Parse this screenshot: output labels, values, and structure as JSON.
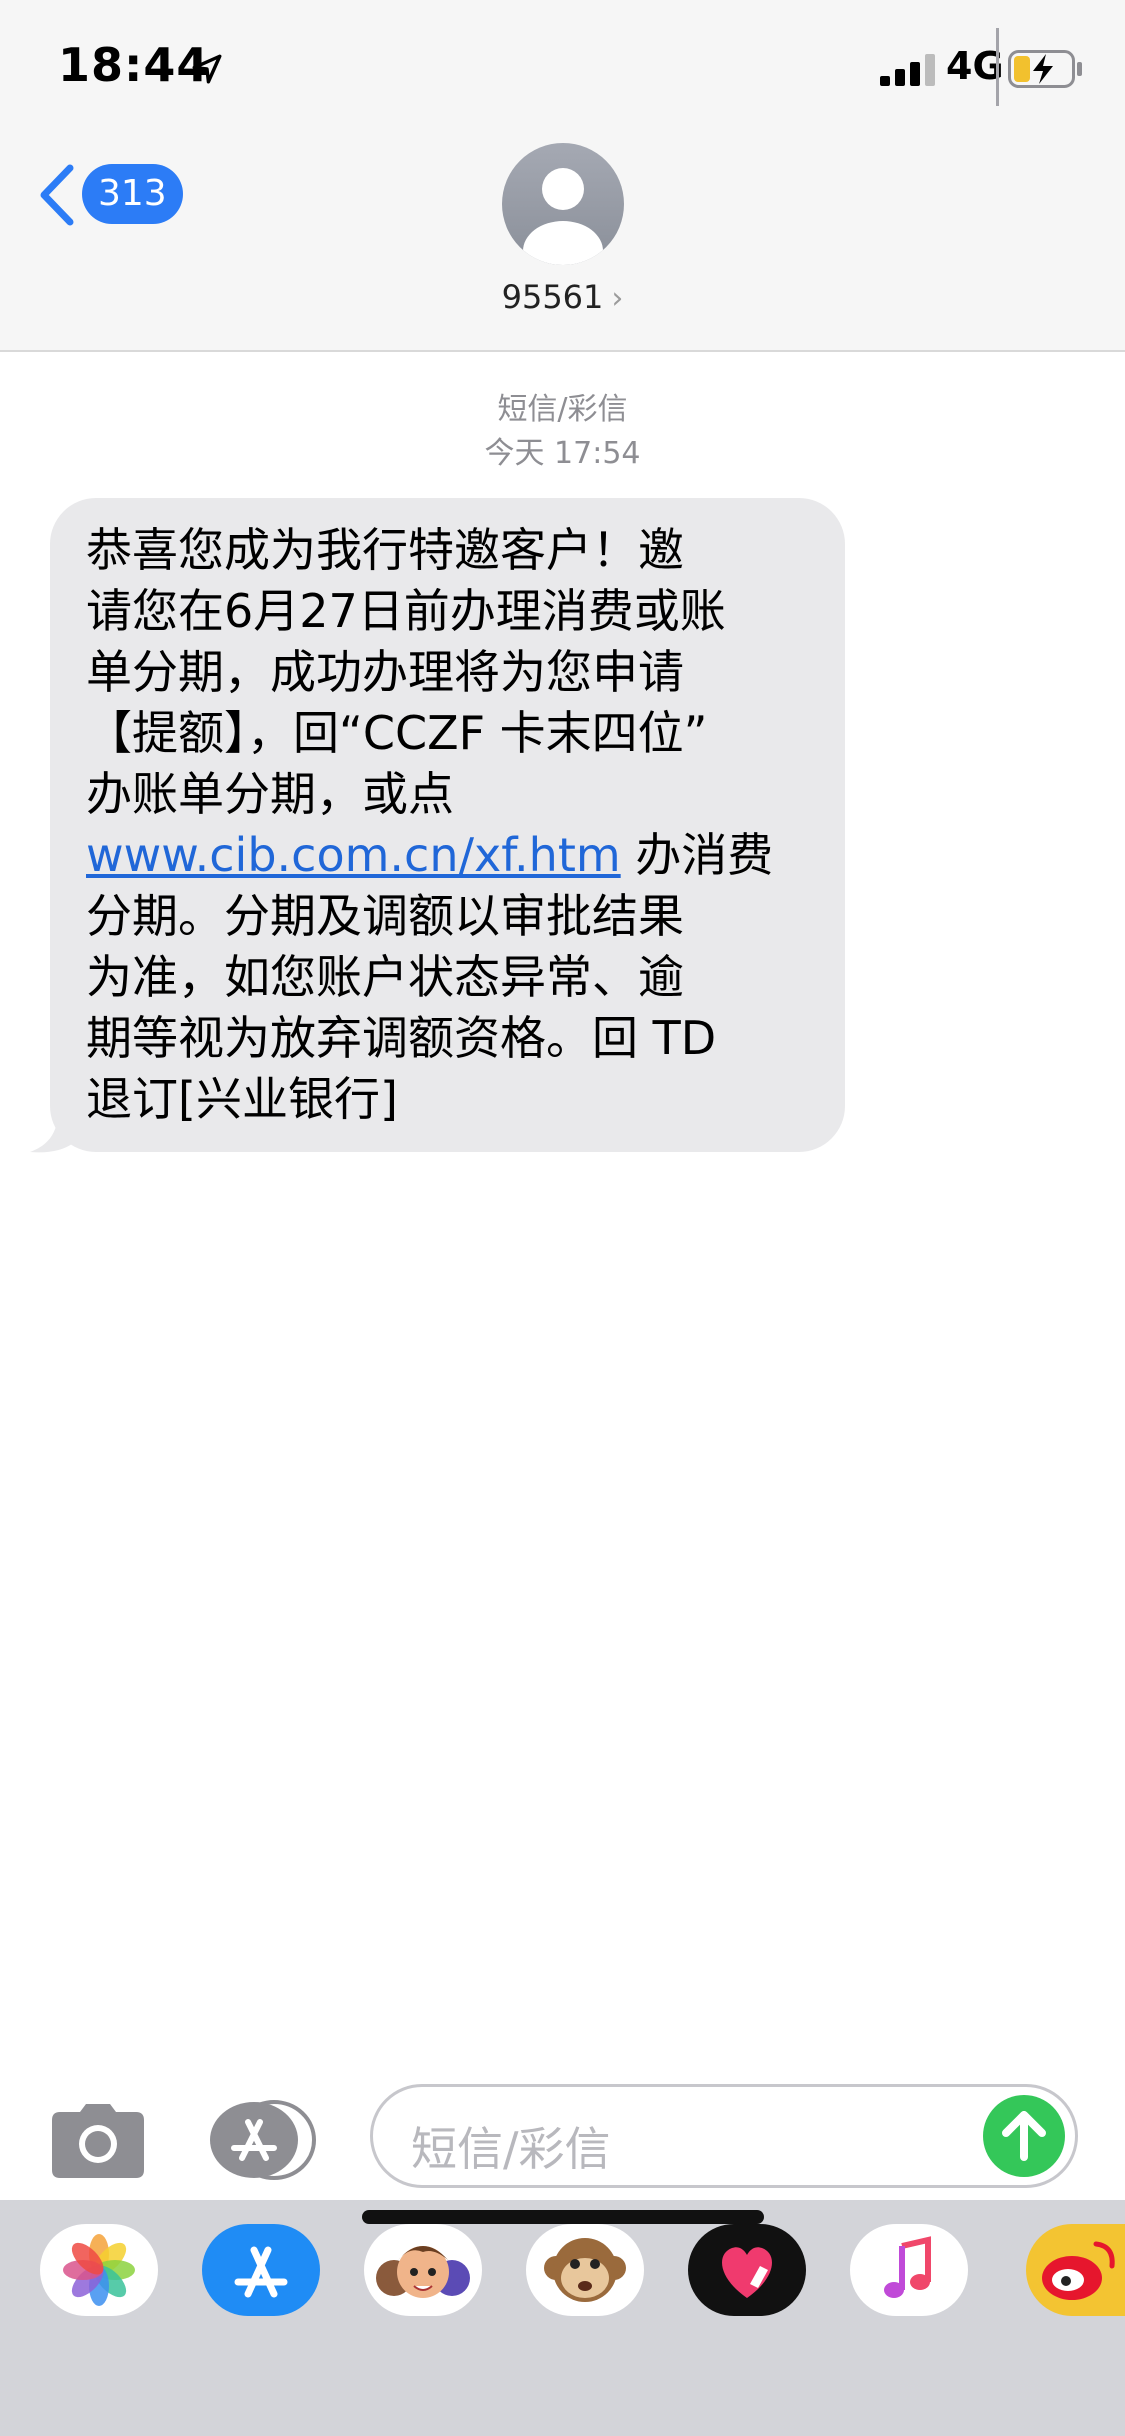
{
  "status_bar": {
    "time": "18:44",
    "network": "4G",
    "icons": [
      "location-arrow-icon",
      "cellular-signal-icon",
      "battery-charging-icon"
    ]
  },
  "header": {
    "back_count": "313",
    "contact_number": "95561",
    "contact_chevron": "›",
    "accent_color": "#2c7cf6"
  },
  "conversation": {
    "type_label": "短信/彩信",
    "timestamp": "今天 17:54"
  },
  "message": {
    "text_before_link": "恭喜您成为我行特邀客户！邀\n请您在6月27日前办理消费或账\n单分期，成功办理将为您申请\n【提额】，回“CCZF 卡末四位”\n办账单分期，或点\n",
    "link": "www.cib.com.cn/xf.htm",
    "text_after_link": " 办消费\n分期。分期及调额以审批结果\n为准，如您账户状态异常、逾\n期等视为放弃调额资格。回 TD\n退订[兴业银行]",
    "bubble_color": "#e9e9eb",
    "link_color": "#2067d8"
  },
  "compose": {
    "placeholder": "短信/彩信",
    "send_color": "#34c759"
  },
  "dock": {
    "apps": [
      "photos-icon",
      "app-store-icon",
      "memoji-icon",
      "animoji-monkey-icon",
      "digital-touch-icon",
      "music-icon",
      "weibo-icon"
    ]
  }
}
